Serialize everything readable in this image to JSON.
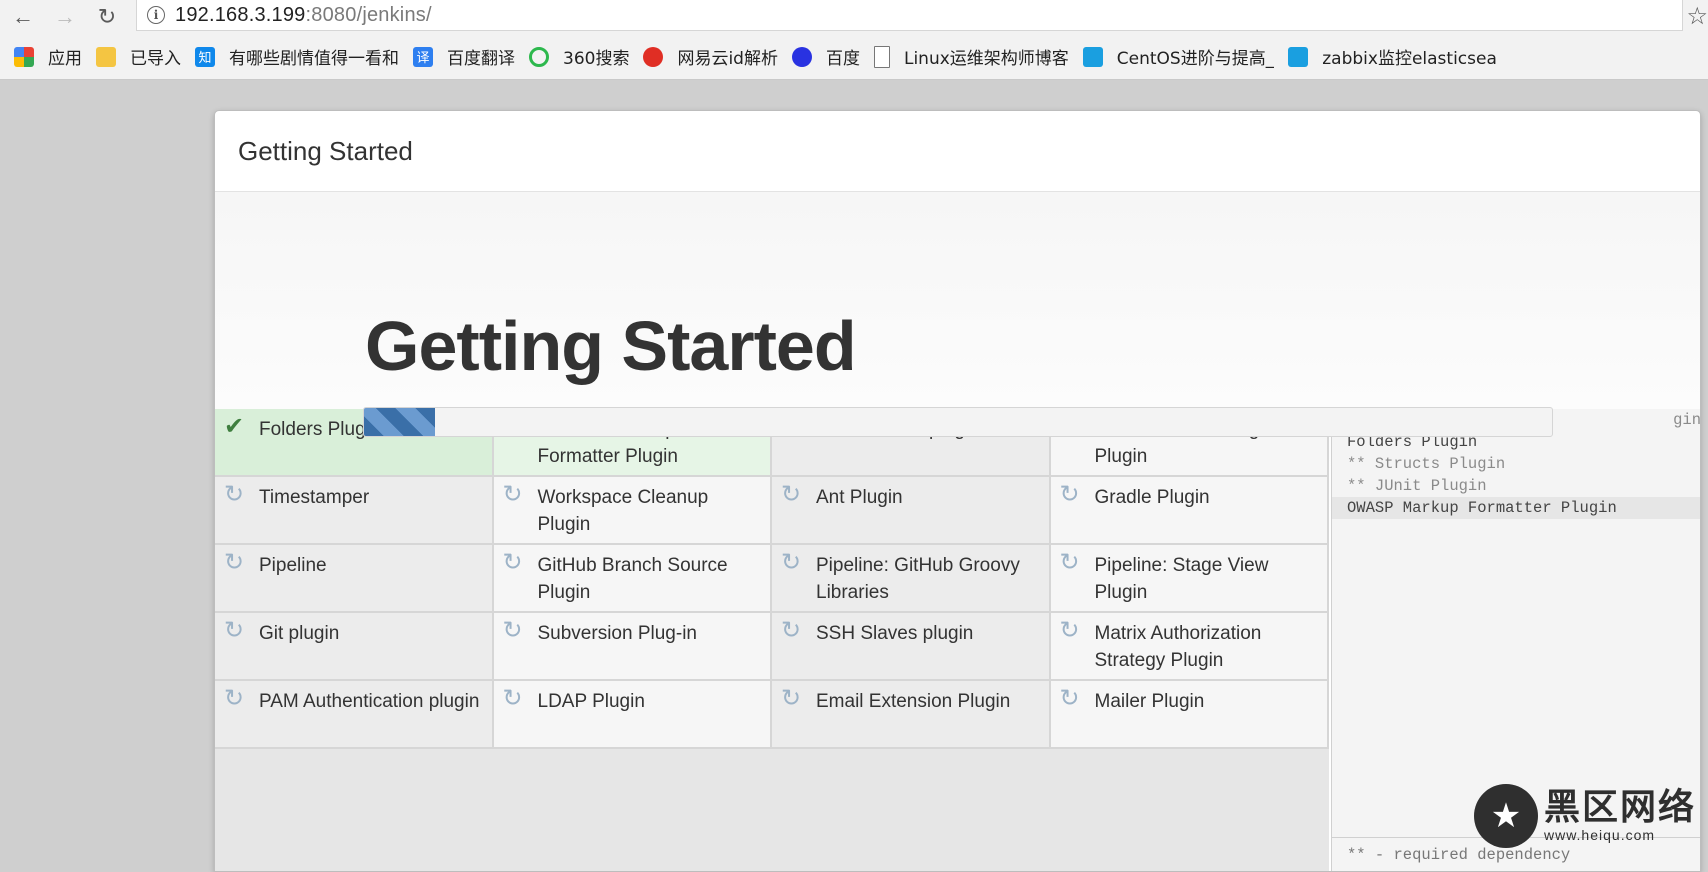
{
  "browser": {
    "url_host": "192.168.3.199",
    "url_path": ":8080/jenkins/",
    "bookmarks": [
      {
        "label": "应用",
        "icon": "apps-grid-icon",
        "color": "#e94235"
      },
      {
        "label": "已导入",
        "icon": "folder-icon",
        "color": "#f4c542"
      },
      {
        "label": "有哪些剧情值得一看和",
        "icon": "zhihu-icon",
        "color": "#0f88eb",
        "glyph": "知"
      },
      {
        "label": "百度翻译",
        "icon": "baidu-translate-icon",
        "color": "#2e7ff0",
        "glyph": "译"
      },
      {
        "label": "360搜索",
        "icon": "360-search-icon",
        "color": "#2db84d"
      },
      {
        "label": "网易云id解析",
        "icon": "netease-music-icon",
        "color": "#e02e24"
      },
      {
        "label": "百度",
        "icon": "baidu-paw-icon",
        "color": "#2932e1"
      },
      {
        "label": "Linux运维架构师博客",
        "icon": "page-icon",
        "color": "#ffffff"
      },
      {
        "label": "CentOS进阶与提高_",
        "icon": "bookmark-blue-icon",
        "color": "#1a9fe0"
      },
      {
        "label": "zabbix监控elasticsea",
        "icon": "bookmark-blue-icon",
        "color": "#1a9fe0"
      }
    ]
  },
  "dialog": {
    "header_title": "Getting Started",
    "hero_title": "Getting Started",
    "progress_fraction": 0.06,
    "plugins": [
      {
        "name": "Folders Plugin",
        "status": "done"
      },
      {
        "name": "OWASP Markup Formatter Plugin",
        "status": "done"
      },
      {
        "name": "build timeout plugin",
        "status": "pending"
      },
      {
        "name": "Credentials Binding Plugin",
        "status": "pending"
      },
      {
        "name": "Timestamper",
        "status": "pending"
      },
      {
        "name": "Workspace Cleanup Plugin",
        "status": "pending"
      },
      {
        "name": "Ant Plugin",
        "status": "pending"
      },
      {
        "name": "Gradle Plugin",
        "status": "pending"
      },
      {
        "name": "Pipeline",
        "status": "pending"
      },
      {
        "name": "GitHub Branch Source Plugin",
        "status": "pending"
      },
      {
        "name": "Pipeline: GitHub Groovy Libraries",
        "status": "pending"
      },
      {
        "name": "Pipeline: Stage View Plugin",
        "status": "pending"
      },
      {
        "name": "Git plugin",
        "status": "pending"
      },
      {
        "name": "Subversion Plug-in",
        "status": "pending"
      },
      {
        "name": "SSH Slaves plugin",
        "status": "pending"
      },
      {
        "name": "Matrix Authorization Strategy Plugin",
        "status": "pending"
      },
      {
        "name": "PAM Authentication plugin",
        "status": "pending"
      },
      {
        "name": "LDAP Plugin",
        "status": "pending"
      },
      {
        "name": "Email Extension Plugin",
        "status": "pending"
      },
      {
        "name": "Mailer Plugin",
        "status": "pending"
      }
    ],
    "log_lines": [
      {
        "text": "gin",
        "dim": true
      },
      {
        "text": "Folders Plugin",
        "dim": false
      },
      {
        "text": "** Structs Plugin",
        "dim": true
      },
      {
        "text": "** JUnit Plugin",
        "dim": true
      },
      {
        "text": "OWASP Markup Formatter Plugin",
        "dim": false,
        "highlight": true
      }
    ],
    "log_footer": "** - required dependency"
  },
  "watermark": {
    "cn": "黑区网络",
    "url": "www.heiqu.com"
  }
}
